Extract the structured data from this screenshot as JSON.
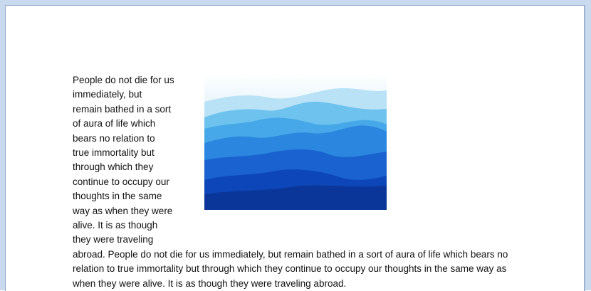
{
  "document": {
    "wrapped_lines": [
      "People do not die for us",
      "immediately, but",
      "remain bathed in a sort",
      "of aura of life which",
      "bears no relation to",
      "true immortality but",
      "through which they",
      "continue to occupy our",
      "thoughts in the same",
      "way as when they were",
      "alive. It is as though",
      "they were traveling"
    ],
    "full_lines": [
      "abroad. People do not die for us immediately, but remain bathed in a sort of aura of life which bears no",
      "relation to true immortality but through which they continue to occupy our thoughts in the same way as",
      "when they were alive. It is as though they were traveling abroad."
    ],
    "image": {
      "name": "blue-mountains-picture",
      "colors": {
        "sky_top": "#ffffff",
        "sky_bottom": "#9ad5f3",
        "ridge_1": "#6ec3ee",
        "ridge_2": "#46a8e8",
        "ridge_3": "#2a86df",
        "ridge_4": "#1a62cf",
        "ridge_5": "#0d46b8",
        "ridge_6": "#0a369a"
      }
    }
  }
}
